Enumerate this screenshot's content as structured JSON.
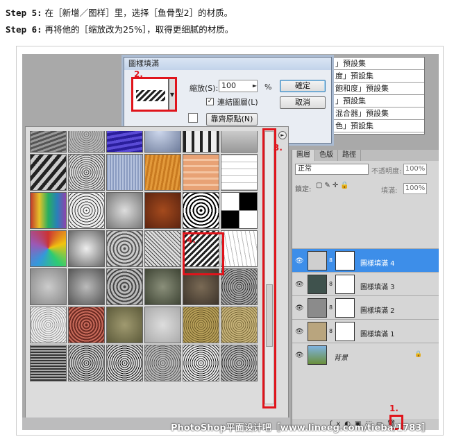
{
  "steps": [
    {
      "label": "Step 5:",
      "text": "在［新增／图样］里，选择［鱼骨型2］的材质。"
    },
    {
      "label": "Step 6:",
      "text": "再将他的［缩放改为25%］，取得更细腻的材质。"
    }
  ],
  "presets": [
    "」預設集",
    "度」預設集",
    "飽和度」預設集",
    "」預設集",
    "混合器」預設集",
    "色」預設集"
  ],
  "dialog": {
    "title": "圖樣填滿",
    "scale_label": "縮放(S):",
    "scale_value": "100",
    "scale_unit": "%",
    "ok": "確定",
    "cancel": "取消",
    "link_label": "連結圖層(L)",
    "link_checked": "✓",
    "snap": "靠齊原點(N)"
  },
  "annotations": {
    "a1": "1.",
    "a2": "2.",
    "a3": "3.",
    "a4": "4."
  },
  "layers": {
    "tabs": [
      "圖層",
      "色版",
      "路徑"
    ],
    "blend": "正常",
    "opacity_label": "不透明度:",
    "opacity": "100%",
    "lock_label": "鎖定:",
    "fill_label": "填滿:",
    "fill": "100%",
    "items": [
      {
        "name": "圖樣填滿 4",
        "selected": true
      },
      {
        "name": "圖樣填滿 3",
        "selected": false
      },
      {
        "name": "圖樣填滿 2",
        "selected": false
      },
      {
        "name": "圖樣填滿 1",
        "selected": false
      },
      {
        "name": "背景",
        "selected": false
      }
    ]
  },
  "watermark": "PhotoShop平面设计吧［www.lineeg.com/tieba/1783］"
}
